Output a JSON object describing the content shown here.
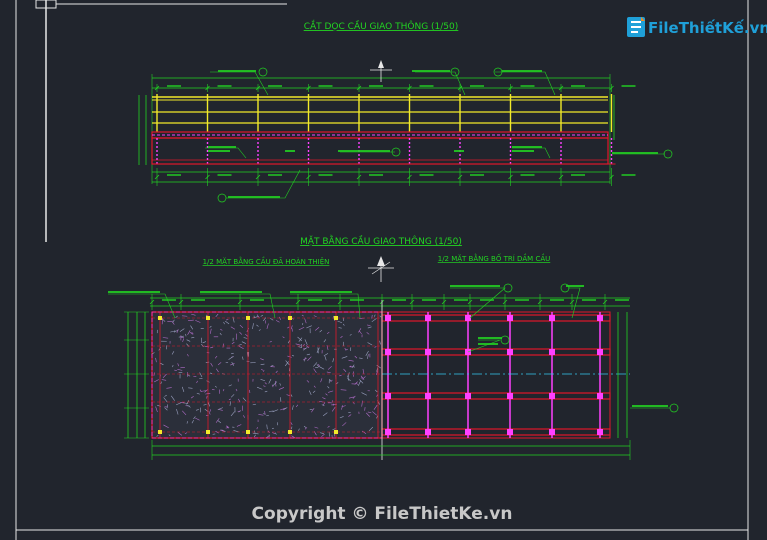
{
  "drawing": {
    "elevation_title": "CẮT DỌC CẦU GIAO THÔNG (1/50)",
    "plan_title": "MẶT BẰNG CẦU GIAO THÔNG (1/50)",
    "plan_left_subtitle": "1/2 MẶT BẰNG CẦU ĐÃ HOÀN THIỆN",
    "plan_right_subtitle": "1/2 MẶT BẰNG BỐ TRÍ DẦM CẦU",
    "copyright": "Copyright © FileThietKe.vn"
  },
  "logo": {
    "text": "FileThiếtKế.vn"
  },
  "colors": {
    "background": "#21252d",
    "green": "#22d422",
    "yellow": "#f2ea2a",
    "red": "#e0182a",
    "magenta": "#ff40ff",
    "white": "#e8e8e8",
    "cyan": "#35c8f0",
    "logo_blue": "#1fa0d8",
    "logo_orange": "#f08a1e"
  }
}
